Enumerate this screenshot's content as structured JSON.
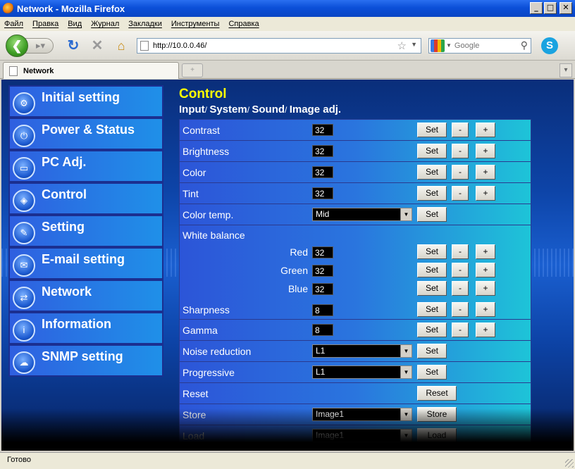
{
  "window": {
    "title": "Network - Mozilla Firefox"
  },
  "menu": [
    "Файл",
    "Правка",
    "Вид",
    "Журнал",
    "Закладки",
    "Инструменты",
    "Справка"
  ],
  "toolbar": {
    "url": "http://10.0.0.46/",
    "search_placeholder": "Google"
  },
  "tab": {
    "title": "Network"
  },
  "sidebar": {
    "items": [
      {
        "label": "Initial setting",
        "icon": "settings-icon"
      },
      {
        "label": "Power & Status",
        "icon": "power-icon"
      },
      {
        "label": "PC Adj.",
        "icon": "monitor-icon"
      },
      {
        "label": "Control",
        "icon": "control-icon"
      },
      {
        "label": "Setting",
        "icon": "wrench-icon"
      },
      {
        "label": "E-mail setting",
        "icon": "mail-icon"
      },
      {
        "label": "Network",
        "icon": "network-icon"
      },
      {
        "label": "Information",
        "icon": "info-icon"
      },
      {
        "label": "SNMP setting",
        "icon": "snmp-icon"
      }
    ]
  },
  "main": {
    "title": "Control",
    "breadcrumb": [
      "Input",
      "System",
      "Sound",
      "Image adj."
    ],
    "buttons": {
      "set": "Set",
      "minus": "-",
      "plus": "+",
      "reset": "Reset",
      "store": "Store",
      "load": "Load"
    },
    "rows": {
      "contrast": {
        "label": "Contrast",
        "value": "32"
      },
      "brightness": {
        "label": "Brightness",
        "value": "32"
      },
      "color": {
        "label": "Color",
        "value": "32"
      },
      "tint": {
        "label": "Tint",
        "value": "32"
      },
      "color_temp": {
        "label": "Color temp.",
        "value": "Mid"
      },
      "white_balance": {
        "label": "White balance",
        "red": {
          "label": "Red",
          "value": "32"
        },
        "green": {
          "label": "Green",
          "value": "32"
        },
        "blue": {
          "label": "Blue",
          "value": "32"
        }
      },
      "sharpness": {
        "label": "Sharpness",
        "value": "8"
      },
      "gamma": {
        "label": "Gamma",
        "value": "8"
      },
      "noise_reduction": {
        "label": "Noise reduction",
        "value": "L1"
      },
      "progressive": {
        "label": "Progressive",
        "value": "L1"
      },
      "reset": {
        "label": "Reset"
      },
      "store": {
        "label": "Store",
        "value": "Image1"
      },
      "load": {
        "label": "Load",
        "value": "Image1"
      }
    }
  },
  "status": {
    "text": "Готово"
  }
}
